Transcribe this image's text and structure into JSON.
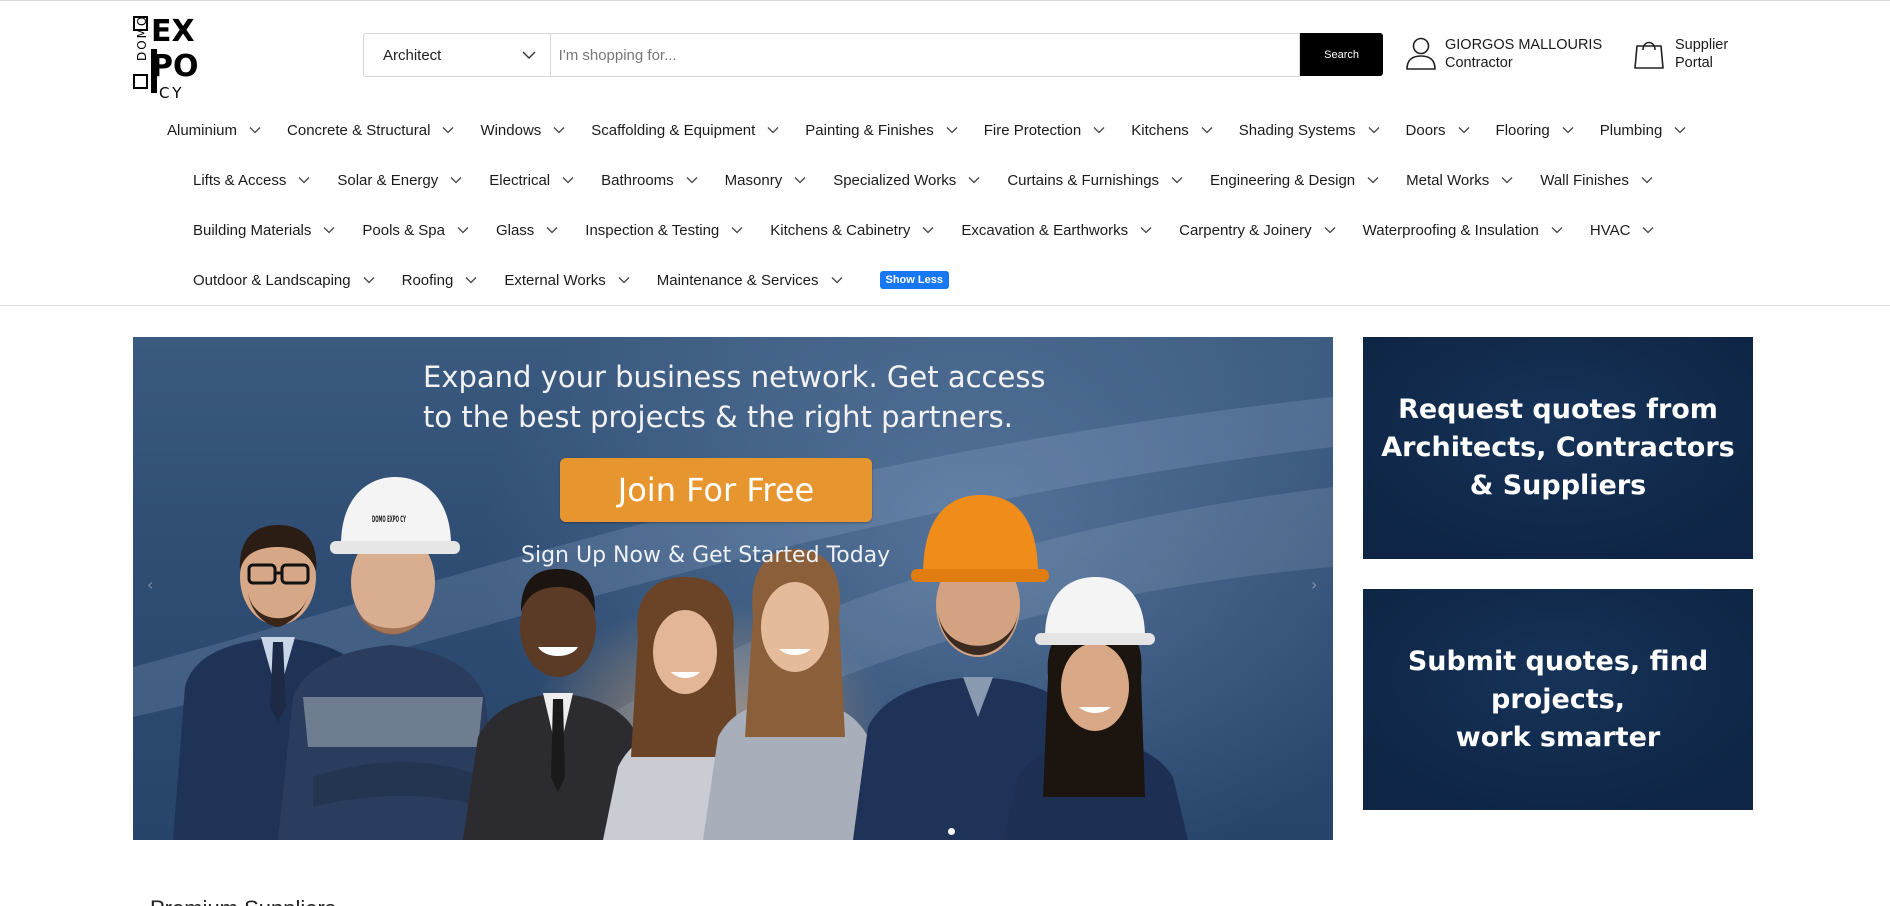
{
  "header": {
    "logo_text": "DOMO EXPO CY",
    "search": {
      "category_value": "Architect",
      "placeholder": "I'm shopping for...",
      "button_label": "Search"
    },
    "user": {
      "name": "GIORGOS MALLOURIS",
      "role": "Contractor",
      "icon": "user-icon"
    },
    "supplier": {
      "line1": "Supplier",
      "line2": "Portal",
      "icon": "shopping-bag-icon"
    }
  },
  "nav": {
    "rows": [
      [
        "Aluminium",
        "Concrete & Structural",
        "Windows",
        "Scaffolding & Equipment",
        "Painting & Finishes",
        "Fire Protection",
        "Kitchens",
        "Shading Systems",
        "Doors",
        "Flooring",
        "Plumbing"
      ],
      [
        "Lifts & Access",
        "Solar & Energy",
        "Electrical",
        "Bathrooms",
        "Masonry",
        "Specialized Works",
        "Curtains & Furnishings",
        "Engineering & Design",
        "Metal Works",
        "Wall Finishes"
      ],
      [
        "Building Materials",
        "Pools & Spa",
        "Glass",
        "Inspection & Testing",
        "Kitchens & Cabinetry",
        "Excavation & Earthworks",
        "Carpentry & Joinery",
        "Waterproofing & Insulation",
        "HVAC"
      ],
      [
        "Outdoor & Landscaping",
        "Roofing",
        "External Works",
        "Maintenance & Services"
      ]
    ],
    "show_less_label": "Show Less",
    "show_less_color": "#1877f2"
  },
  "hero": {
    "headline_line1": "Expand your business network. Get access",
    "headline_line2": "to the best projects & the right partners.",
    "cta_label": "Join For Free",
    "cta_color": "#e7962f",
    "subtext": "Sign Up Now & Get Started Today",
    "helmet_logo_text": "DOMO EXPO CY",
    "prev_arrow": "‹",
    "next_arrow": "›"
  },
  "side_cards": {
    "card1": {
      "line1": "Request quotes from",
      "line2": "Architects, Contractors",
      "line3": "& Suppliers"
    },
    "card2": {
      "line1": "Submit quotes, find projects,",
      "line2": "work smarter"
    },
    "background_color": "#0e2747"
  },
  "section_peek": "Premium Suppliers"
}
